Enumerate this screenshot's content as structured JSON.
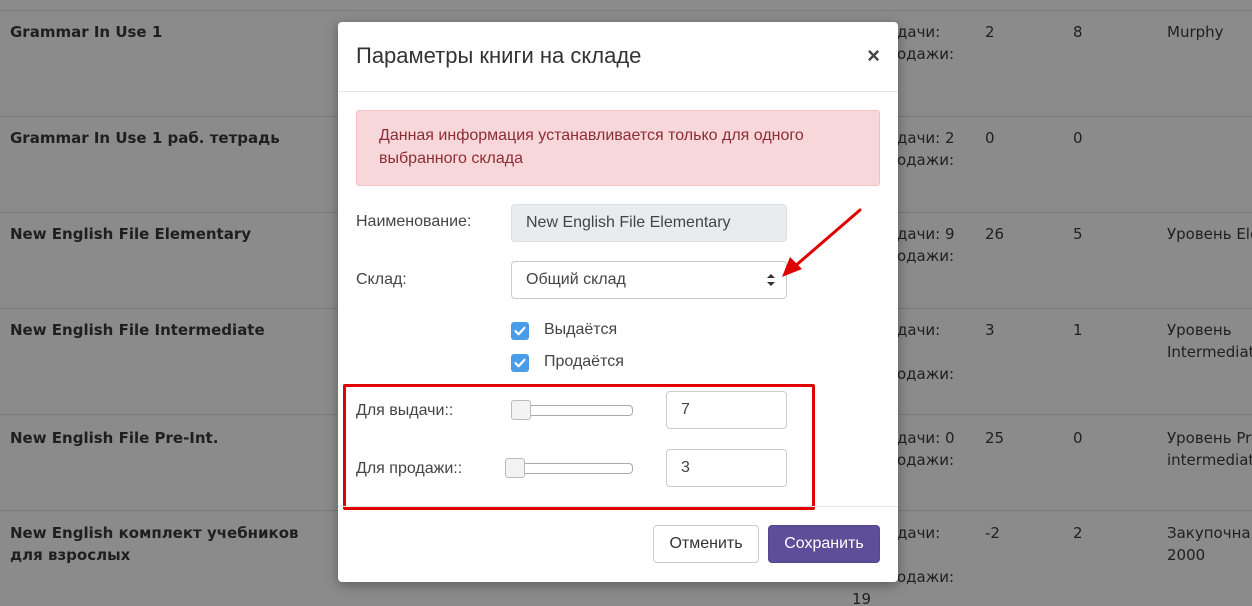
{
  "background_table": {
    "rows": [
      {
        "title": "Grammar In Use 1",
        "col1_line1": "дачи:",
        "col1_line2": "одажи:",
        "col2": "2",
        "col3": "8",
        "col4_line1": "Murphy",
        "col4_line2": ""
      },
      {
        "title": "Grammar In Use 1 раб. тетрадь",
        "col1_line1": "дачи: 2",
        "col1_line2": "одажи:",
        "col2": "0",
        "col3": "0",
        "col4_line1": "",
        "col4_line2": ""
      },
      {
        "title": "New English File Elementary",
        "col1_line1": "дачи: 9",
        "col1_line2": "одажи:",
        "col2": "26",
        "col3": "5",
        "col4_line1": "Уровень Ele",
        "col4_line2": ""
      },
      {
        "title": "New English File Intermediate",
        "col1_line1": "дачи:",
        "col1_line2": "одажи:",
        "col2": "3",
        "col3": "1",
        "col4_line1": "Уровень",
        "col4_line2": "Intermediate"
      },
      {
        "title": "New English File Pre-Int.",
        "col1_line1": "дачи: 0",
        "col1_line2": "одажи:",
        "col2": "25",
        "col3": "0",
        "col4_line1": "Уровень Pre-",
        "col4_line2": "intermediate"
      },
      {
        "title": "New English комплект учебников для взрослых",
        "col1_line1": "дачи:",
        "col1_line2": "одажи:",
        "col1_line3": "19",
        "col2": "-2",
        "col3": "2",
        "col4_line1": "Закупочная",
        "col4_line2": "2000"
      }
    ]
  },
  "modal": {
    "title": "Параметры книги на складе",
    "close_label": "×",
    "alert_text": "Данная информация устанавливается только для одного выбранного склада",
    "name_label": "Наименование:",
    "name_value": "New English File Elementary",
    "warehouse_label": "Склад:",
    "warehouse_value": "Общий склад",
    "checkbox_issued": "Выдаётся",
    "checkbox_sold": "Продаётся",
    "issue_label": "Для выдачи::",
    "issue_value": "7",
    "sale_label": "Для продажи::",
    "sale_value": "3",
    "cancel_label": "Отменить",
    "save_label": "Сохранить"
  },
  "colors": {
    "accent": "#5c4e99",
    "alert_bg": "#f8d7da",
    "highlight": "#e00000",
    "checkbox": "#4a9be8"
  },
  "icons": [
    "close-icon",
    "select-arrows-icon",
    "check-icon",
    "annotation-arrow-icon"
  ]
}
